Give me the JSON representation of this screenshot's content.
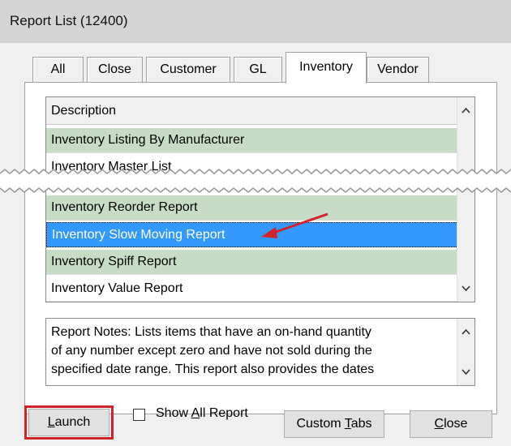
{
  "window": {
    "title": "Report List (12400)"
  },
  "tabs": [
    {
      "label": "All"
    },
    {
      "label": "Close"
    },
    {
      "label": "Customer"
    },
    {
      "label": "GL"
    },
    {
      "label": "Inventory"
    },
    {
      "label": "Vendor"
    }
  ],
  "list": {
    "header": "Description",
    "rows_top": [
      {
        "label": "Inventory Listing By Manufacturer"
      },
      {
        "label": "Inventory Master List"
      }
    ],
    "rows_bottom": [
      {
        "label": "Inventory Reorder Report"
      },
      {
        "label": "Inventory Slow Moving Report"
      },
      {
        "label": "Inventory Spiff Report"
      },
      {
        "label": "Inventory Value Report"
      }
    ],
    "selected": "Inventory Slow Moving Report"
  },
  "notes": {
    "lines": [
      "Report Notes:  Lists items that have an on-hand quantity",
      "of any number except zero and have not sold during the",
      "specified date range. This report also provides the dates"
    ]
  },
  "buttons": {
    "launch_prefix": "",
    "launch_mnemonic": "L",
    "launch_rest": "aunch",
    "show_all_prefix": "Show ",
    "show_all_mnemonic": "A",
    "show_all_rest": "ll Report",
    "custom_prefix": "Custom ",
    "custom_mnemonic": "T",
    "custom_rest": "abs",
    "close_prefix": "",
    "close_mnemonic": "C",
    "close_rest": "lose"
  },
  "colors": {
    "row_green": "#c6dcc4",
    "selection": "#3399ff",
    "annotation_red": "#d2232a"
  },
  "icons": {
    "scroll_up": "chevron-up-icon",
    "scroll_down": "chevron-down-icon",
    "annotation": "red-arrow-icon"
  }
}
